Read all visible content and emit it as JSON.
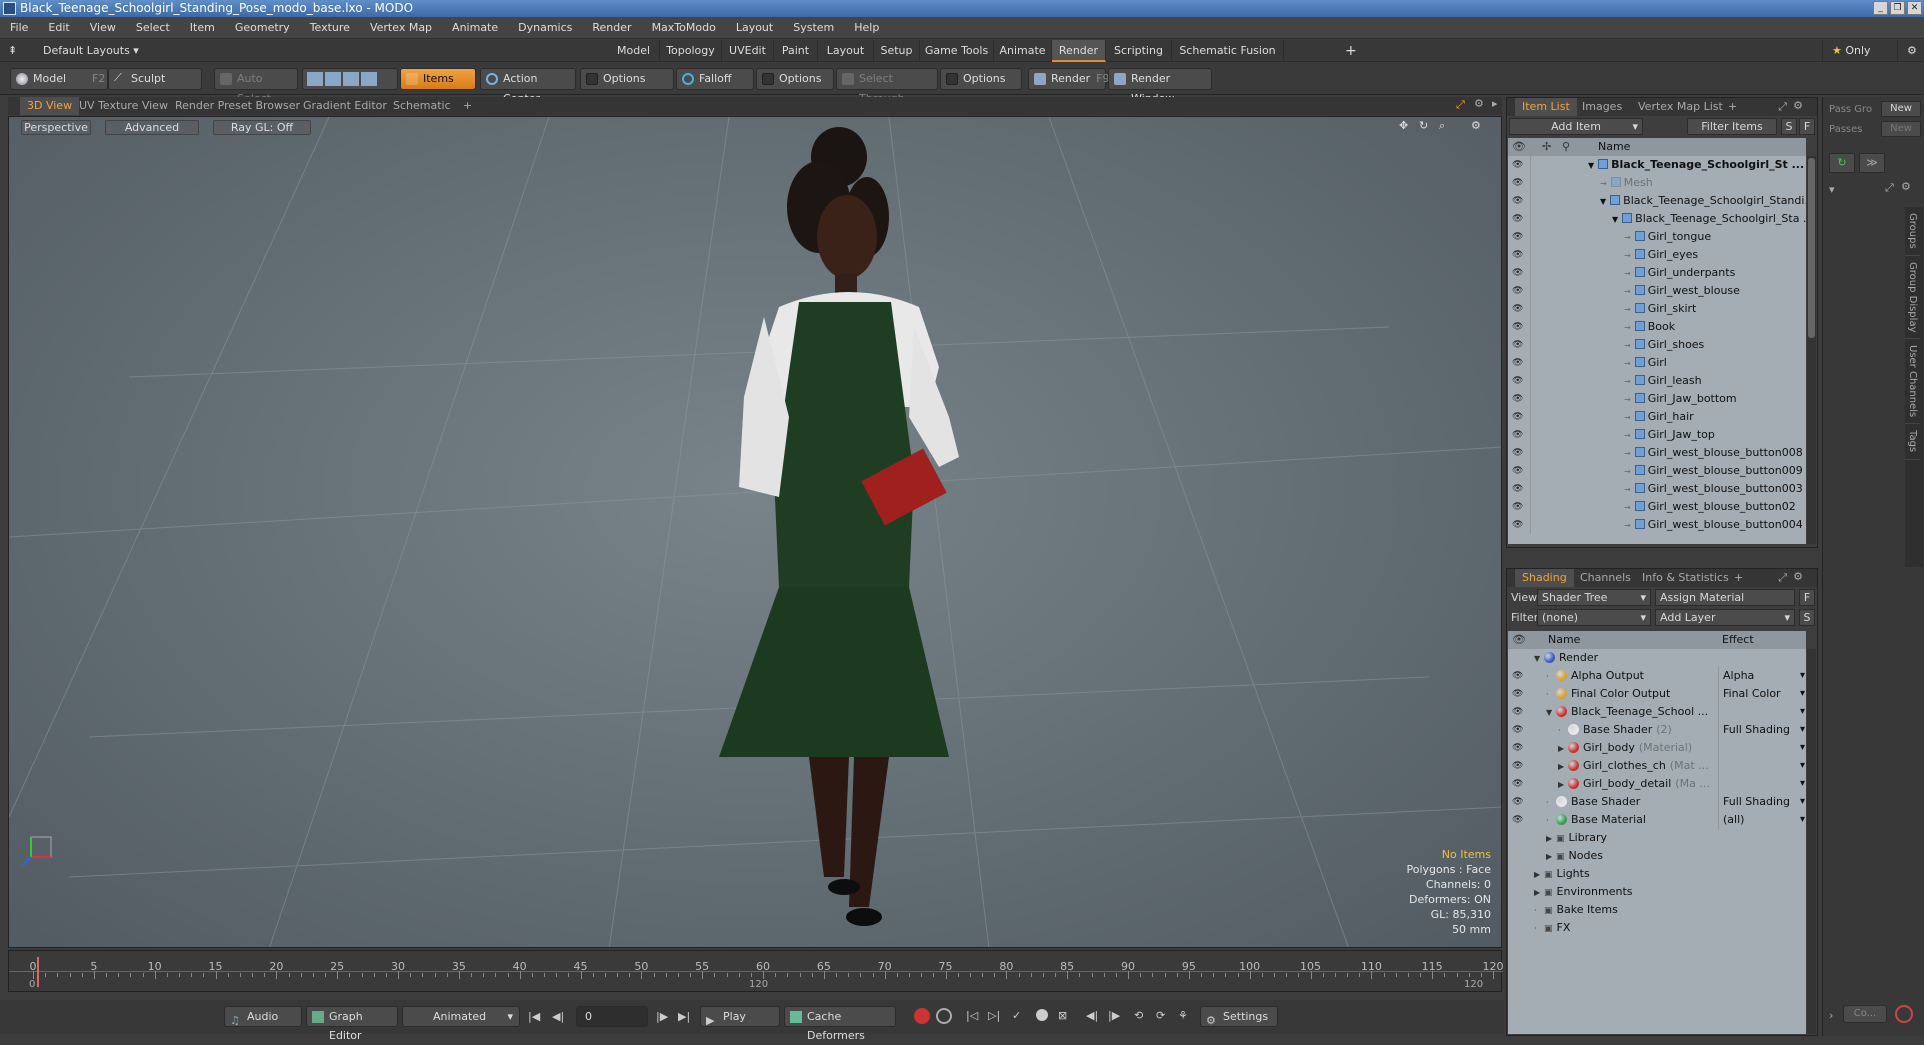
{
  "window": {
    "title": "Black_Teenage_Schoolgirl_Standing_Pose_modo_base.lxo - MODO"
  },
  "menu": [
    "File",
    "Edit",
    "View",
    "Select",
    "Item",
    "Geometry",
    "Texture",
    "Vertex Map",
    "Animate",
    "Dynamics",
    "Render",
    "MaxToModo",
    "Layout",
    "System",
    "Help"
  ],
  "layout": {
    "label": "Default Layouts ▾",
    "tabs": [
      "Model",
      "Topology",
      "UVEdit",
      "Paint",
      "Layout",
      "Setup",
      "Game Tools",
      "Animate",
      "Render",
      "Scripting",
      "Schematic Fusion"
    ],
    "active_tab": "Render",
    "add": "+",
    "only": "Only"
  },
  "toolbar": {
    "model": "Model",
    "model_key": "F2",
    "sculpt": "Sculpt",
    "auto_select": "Auto Select",
    "items": "Items",
    "action_center": "Action Center",
    "options1": "Options",
    "falloff": "Falloff",
    "options2": "Options",
    "select_through": "Select Through",
    "options3": "Options",
    "render": "Render",
    "render_key": "F9",
    "render_window": "Render Window"
  },
  "viewport_tabs": [
    "3D View",
    "UV Texture View",
    "Render Preset Browser",
    "Gradient Editor",
    "Schematic",
    "+"
  ],
  "viewport": {
    "perspective": "Perspective",
    "advanced": "Advanced",
    "raygl": "Ray GL: Off",
    "info": {
      "no_items": "No Items",
      "polygons": "Polygons : Face",
      "channels": "Channels: 0",
      "deformers": "Deformers: ON",
      "gl": "GL: 85,310",
      "focal": "50 mm"
    }
  },
  "timeline": {
    "ticks": [
      0,
      5,
      10,
      15,
      20,
      25,
      30,
      35,
      40,
      45,
      50,
      55,
      60,
      65,
      70,
      75,
      80,
      85,
      90,
      95,
      100,
      105,
      110,
      115,
      120
    ],
    "start": "0",
    "mid": "120",
    "end": "120"
  },
  "bottombar": {
    "audio": "Audio",
    "graph_editor": "Graph Editor",
    "animated": "Animated",
    "frame": "0",
    "play": "Play",
    "cache": "Cache Deformers",
    "settings": "Settings"
  },
  "item_list": {
    "tabs": [
      "Item List",
      "Images",
      "Vertex Map List",
      "+"
    ],
    "add_item": "Add Item",
    "filter_items": "Filter Items",
    "s": "S",
    "f": "F",
    "col_name": "Name",
    "items": [
      {
        "label": "Black_Teenage_Schoolgirl_St ...",
        "indent": 0,
        "bold": true,
        "arrow": "▼"
      },
      {
        "label": "Mesh",
        "indent": 1,
        "ghost": true,
        "arrow": ""
      },
      {
        "label": "Black_Teenage_Schoolgirl_Standi...",
        "indent": 1,
        "arrow": "▼"
      },
      {
        "label": "Black_Teenage_Schoolgirl_Sta ...",
        "indent": 2,
        "arrow": "▼"
      },
      {
        "label": "Girl_tongue",
        "indent": 3,
        "arrow": ""
      },
      {
        "label": "Girl_eyes",
        "indent": 3,
        "arrow": ""
      },
      {
        "label": "Girl_underpants",
        "indent": 3,
        "arrow": ""
      },
      {
        "label": "Girl_west_blouse",
        "indent": 3,
        "arrow": ""
      },
      {
        "label": "Girl_skirt",
        "indent": 3,
        "arrow": ""
      },
      {
        "label": "Book",
        "indent": 3,
        "arrow": ""
      },
      {
        "label": "Girl_shoes",
        "indent": 3,
        "arrow": ""
      },
      {
        "label": "Girl",
        "indent": 3,
        "arrow": ""
      },
      {
        "label": "Girl_leash",
        "indent": 3,
        "arrow": ""
      },
      {
        "label": "Girl_Jaw_bottom",
        "indent": 3,
        "arrow": ""
      },
      {
        "label": "Girl_hair",
        "indent": 3,
        "arrow": ""
      },
      {
        "label": "Girl_Jaw_top",
        "indent": 3,
        "arrow": ""
      },
      {
        "label": "Girl_west_blouse_button008",
        "indent": 3,
        "arrow": ""
      },
      {
        "label": "Girl_west_blouse_button009",
        "indent": 3,
        "arrow": ""
      },
      {
        "label": "Girl_west_blouse_button003",
        "indent": 3,
        "arrow": ""
      },
      {
        "label": "Girl_west_blouse_button02",
        "indent": 3,
        "arrow": ""
      },
      {
        "label": "Girl_west_blouse_button004",
        "indent": 3,
        "arrow": ""
      }
    ]
  },
  "shading": {
    "tabs": [
      "Shading",
      "Channels",
      "Info & Statistics",
      "+"
    ],
    "view_label": "View",
    "view_value": "Shader Tree",
    "assign": "Assign Material",
    "f": "F",
    "filter_label": "Filter",
    "filter_value": "(none)",
    "add_layer": "Add Layer",
    "s": "S",
    "col_name": "Name",
    "col_effect": "Effect",
    "rows": [
      {
        "label": "Render",
        "sub": "",
        "effect": "",
        "indent": 1,
        "arrow": "▼",
        "ball": "#3a58c8",
        "eye": false
      },
      {
        "label": "Alpha Output",
        "sub": "",
        "effect": "Alpha",
        "indent": 2,
        "arrow": "",
        "ball": "#d8a030",
        "eye": true
      },
      {
        "label": "Final Color Output",
        "sub": "",
        "effect": "Final Color",
        "indent": 2,
        "arrow": "",
        "ball": "#d8a030",
        "eye": true
      },
      {
        "label": "Black_Teenage_School ...",
        "sub": "",
        "effect": "",
        "indent": 2,
        "arrow": "▼",
        "ball": "#c83030",
        "eye": true
      },
      {
        "label": "Base Shader",
        "sub": "(2)",
        "effect": "Full Shading",
        "indent": 3,
        "arrow": "",
        "ball": "#e8e8e8",
        "eye": true
      },
      {
        "label": "Girl_body",
        "sub": "(Material)",
        "effect": "",
        "indent": 3,
        "arrow": "▶",
        "ball": "#c83030",
        "eye": true
      },
      {
        "label": "Girl_clothes_ch",
        "sub": "(Mat ...",
        "effect": "",
        "indent": 3,
        "arrow": "▶",
        "ball": "#c83030",
        "eye": true
      },
      {
        "label": "Girl_body_detail",
        "sub": "(Ma ...",
        "effect": "",
        "indent": 3,
        "arrow": "▶",
        "ball": "#c83030",
        "eye": true
      },
      {
        "label": "Base Shader",
        "sub": "",
        "effect": "Full Shading",
        "indent": 2,
        "arrow": "",
        "ball": "#e8e8e8",
        "eye": true
      },
      {
        "label": "Base Material",
        "sub": "",
        "effect": "(all)",
        "indent": 2,
        "arrow": "",
        "ball": "#30a050",
        "eye": true
      },
      {
        "label": "Library",
        "sub": "",
        "effect": "",
        "indent": 2,
        "arrow": "▶",
        "ball": "",
        "eye": false
      },
      {
        "label": "Nodes",
        "sub": "",
        "effect": "",
        "indent": 2,
        "arrow": "▶",
        "ball": "",
        "eye": false
      },
      {
        "label": "Lights",
        "sub": "",
        "effect": "",
        "indent": 1,
        "arrow": "▶",
        "ball": "",
        "eye": false
      },
      {
        "label": "Environments",
        "sub": "",
        "effect": "",
        "indent": 1,
        "arrow": "▶",
        "ball": "",
        "eye": false
      },
      {
        "label": "Bake Items",
        "sub": "",
        "effect": "",
        "indent": 1,
        "arrow": "",
        "ball": "",
        "eye": false
      },
      {
        "label": "FX",
        "sub": "",
        "effect": "",
        "indent": 1,
        "arrow": "",
        "ball": "",
        "eye": false
      }
    ]
  },
  "pass": {
    "pass_groups": "Pass Gro",
    "new1": "New",
    "passes": "Passes",
    "new2": "New",
    "side_tabs": [
      "Groups",
      "Group Display",
      "User Channels",
      "Tags"
    ],
    "co": "Co..."
  }
}
